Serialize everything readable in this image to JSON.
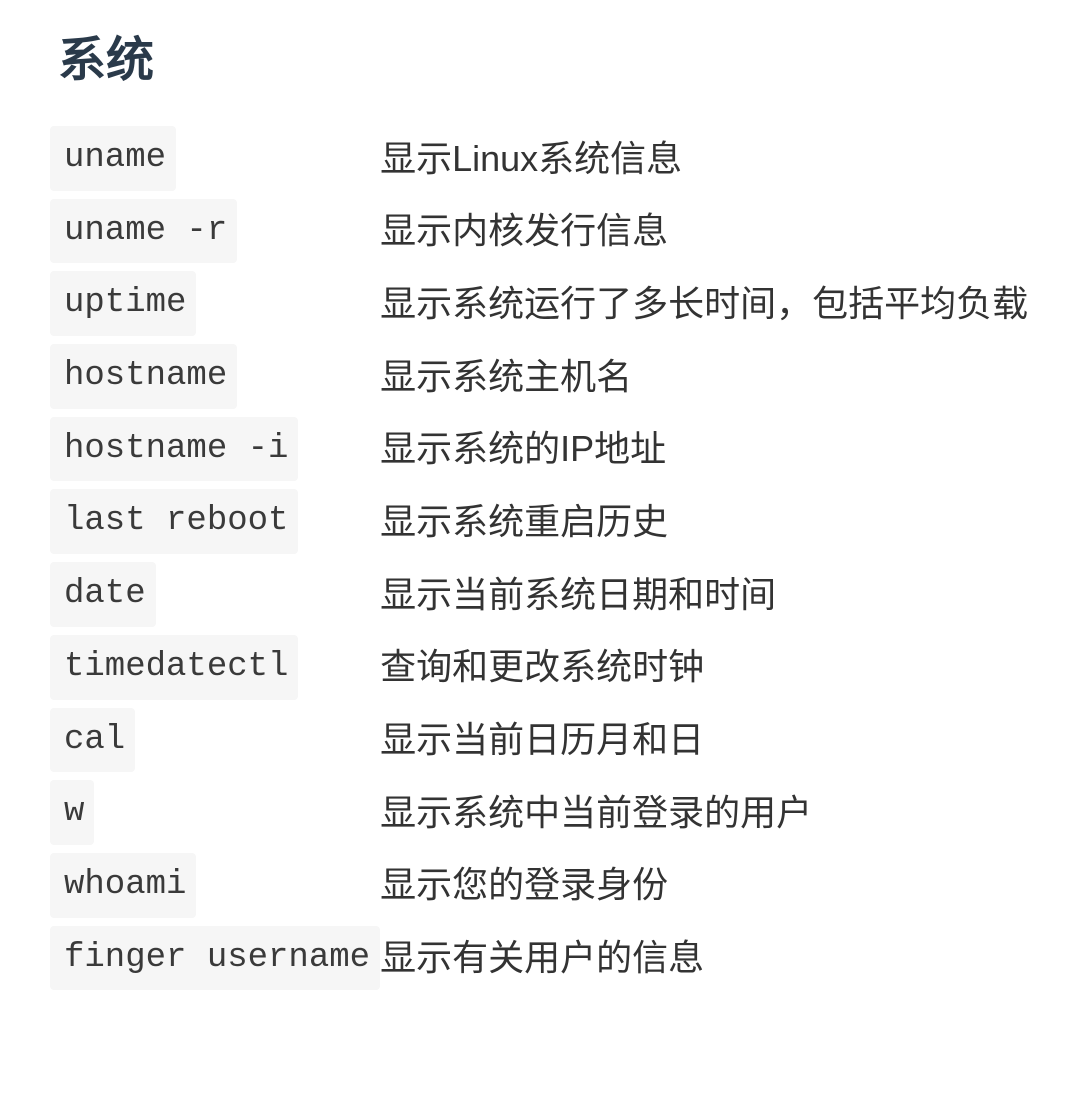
{
  "section": {
    "title": "系统"
  },
  "rows": [
    {
      "cmd": "uname",
      "desc": "显示Linux系统信息"
    },
    {
      "cmd": "uname -r",
      "desc": "显示内核发行信息"
    },
    {
      "cmd": "uptime",
      "desc": "显示系统运行了多长时间，包括平均负载"
    },
    {
      "cmd": "hostname",
      "desc": "显示系统主机名"
    },
    {
      "cmd": "hostname -i",
      "desc": "显示系统的IP地址"
    },
    {
      "cmd": "last reboot",
      "desc": "显示系统重启历史"
    },
    {
      "cmd": "date",
      "desc": "显示当前系统日期和时间"
    },
    {
      "cmd": "timedatectl",
      "desc": "查询和更改系统时钟"
    },
    {
      "cmd": "cal",
      "desc": "显示当前日历月和日"
    },
    {
      "cmd": "w",
      "desc": "显示系统中当前登录的用户"
    },
    {
      "cmd": "whoami",
      "desc": "显示您的登录身份"
    },
    {
      "cmd": "finger username",
      "desc": "显示有关用户的信息"
    }
  ]
}
